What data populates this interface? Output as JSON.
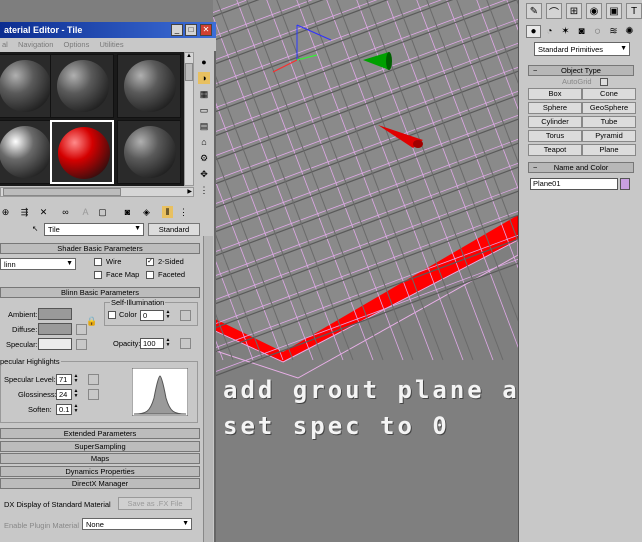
{
  "material_editor": {
    "title": "aterial Editor - Tile",
    "menu": [
      "al",
      "Navigation",
      "Options",
      "Utilities"
    ],
    "material_name": "Tile",
    "material_type": "Standard",
    "shader_section": "Shader Basic Parameters",
    "shader_value": "linn",
    "wire_label": "Wire",
    "two_sided_label": "2-Sided",
    "two_sided_checked": true,
    "face_map_label": "Face Map",
    "faceted_label": "Faceted",
    "blinn_section": "Blinn Basic Parameters",
    "self_illum_label": "Self-Illumination",
    "color_label": "Color",
    "color_value": "0",
    "ambient_label": "Ambient:",
    "diffuse_label": "Diffuse:",
    "specular_label": "Specular:",
    "opacity_label": "Opacity:",
    "opacity_value": "100",
    "spec_highlights_label": "pecular Highlights",
    "spec_level_label": "Specular Level:",
    "spec_level_value": "71",
    "glossiness_label": "Glossiness:",
    "glossiness_value": "24",
    "soften_label": "Soften:",
    "soften_value": "0.1",
    "rollouts": [
      "Extended Parameters",
      "SuperSampling",
      "Maps",
      "Dynamics Properties",
      "DirectX Manager"
    ],
    "dx_display_label": "DX Display of Standard Material",
    "save_fx_label": "Save as .FX File",
    "enable_plugin_label": "Enable Plugin Material",
    "plugin_value": "None",
    "slot_colors": [
      "#5a5a5a",
      "#5a5a5a",
      "#5a5a5a",
      "#6a6a6a",
      "#d40000",
      "#5a5a5a"
    ]
  },
  "command_panel": {
    "primitive_dropdown": "Standard Primitives",
    "object_type_header": "Object Type",
    "autogrid_label": "AutoGrid",
    "buttons": [
      "Box",
      "Cone",
      "Sphere",
      "GeoSphere",
      "Cylinder",
      "Tube",
      "Torus",
      "Pyramid",
      "Teapot",
      "Plane"
    ],
    "name_color_header": "Name and Color",
    "object_name": "Plane01",
    "object_color": "#c8a0e0"
  },
  "viewport": {
    "caption_line1": "add grout plane and",
    "caption_line2": "set spec to 0",
    "plane_color": "#ff0000",
    "wire_color": "#e0a8e8"
  }
}
